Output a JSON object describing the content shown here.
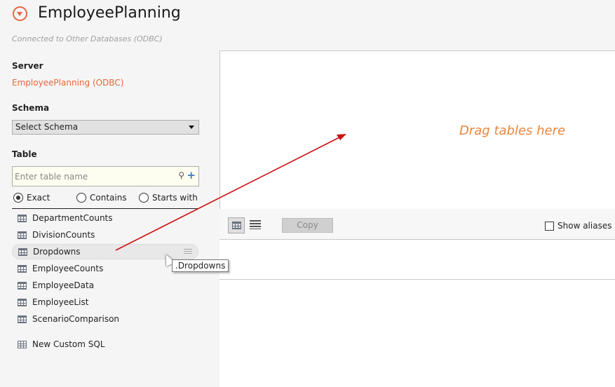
{
  "app": {
    "title": "EmployeePlanning",
    "subtitle": "Connected to Other Databases (ODBC)",
    "accent": "#e8663d"
  },
  "server": {
    "label": "Server",
    "value": "EmployeePlanning (ODBC)"
  },
  "schema": {
    "label": "Schema",
    "selected": "Select Schema"
  },
  "table": {
    "label": "Table",
    "placeholder": "Enter table name",
    "match_options": [
      {
        "label": "Exact",
        "selected": true
      },
      {
        "label": "Contains",
        "selected": false
      },
      {
        "label": "Starts with",
        "selected": false
      }
    ],
    "items": [
      "DepartmentCounts",
      "DivisionCounts",
      "Dropdowns",
      "EmployeeCounts",
      "EmployeeData",
      "EmployeeList",
      "ScenarioComparison"
    ],
    "custom_sql": "New Custom SQL",
    "tooltip": ".Dropdowns"
  },
  "canvas": {
    "drop_hint": "Drag tables here"
  },
  "toolbar": {
    "copy": "Copy",
    "show_aliases": "Show aliases"
  }
}
